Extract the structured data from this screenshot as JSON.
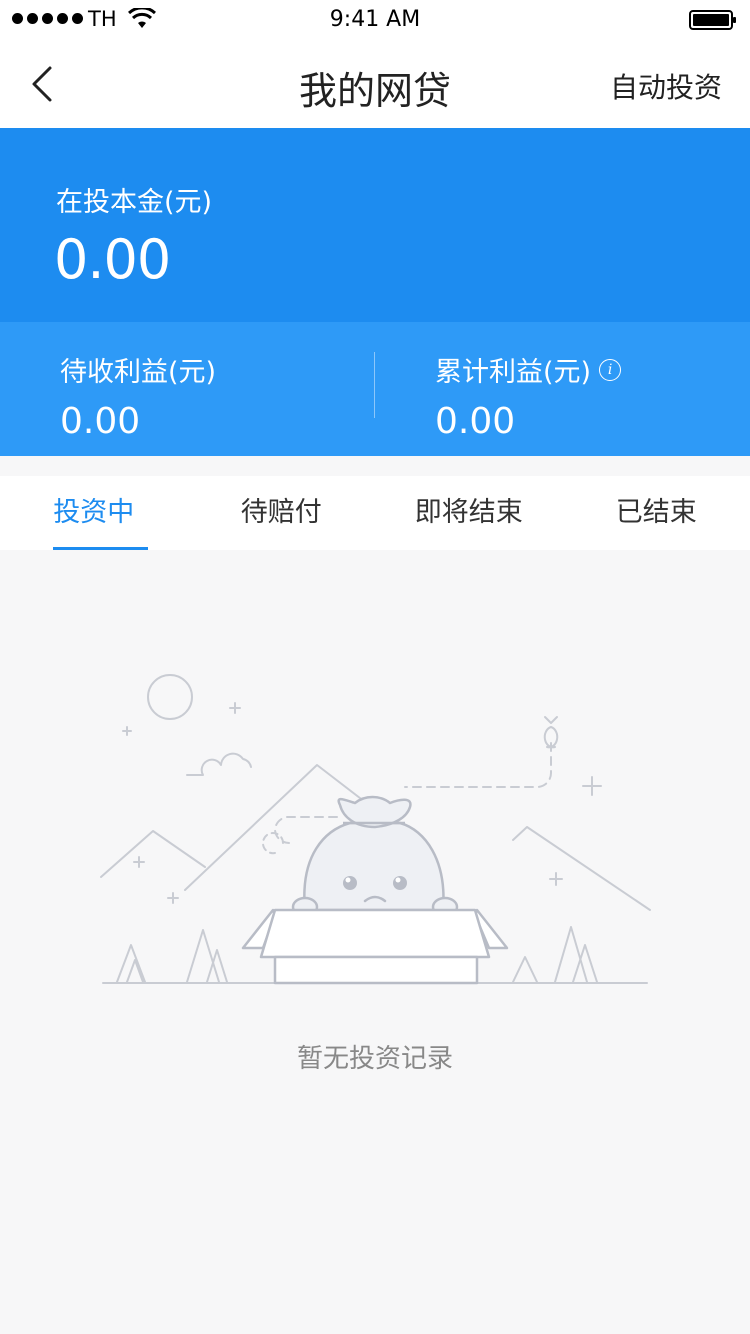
{
  "status_bar": {
    "carrier": "TH",
    "time": "9:41 AM"
  },
  "nav": {
    "title": "我的网贷",
    "action": "自动投资"
  },
  "summary": {
    "principal_label": "在投本金(元)",
    "principal_value": "0.00",
    "pending_label": "待收利益(元)",
    "pending_value": "0.00",
    "total_label": "累计利益(元)",
    "total_value": "0.00"
  },
  "tabs": [
    {
      "label": "投资中",
      "active": true
    },
    {
      "label": "待赔付",
      "active": false
    },
    {
      "label": "即将结束",
      "active": false
    },
    {
      "label": "已结束",
      "active": false
    }
  ],
  "empty_state": {
    "message": "暂无投资记录"
  },
  "colors": {
    "primary": "#1d8cf0",
    "secondary": "#2e9af7",
    "background": "#f7f7f8"
  }
}
